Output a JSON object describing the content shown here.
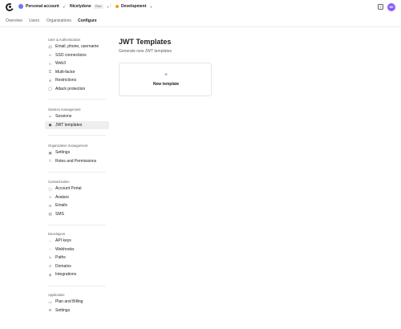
{
  "topbar": {
    "account_label": "Personal account",
    "app_label": "Nicelydone",
    "app_badge": "Free",
    "env_label": "Development",
    "help_glyph": "?",
    "user_initials": "ND",
    "colors": {
      "accent": "#6c47ff",
      "env_dot": "#f59e0b",
      "account_avatar": "#6c73ff",
      "user_avatar": "#8b5cf6"
    }
  },
  "tabs": [
    {
      "label": "Overview"
    },
    {
      "label": "Users"
    },
    {
      "label": "Organizations"
    },
    {
      "label": "Configure",
      "active": true
    }
  ],
  "sidebar": {
    "sections": [
      {
        "title": "User & Authentication",
        "items": [
          {
            "label": "Email, phone, username",
            "icon": "at-icon"
          },
          {
            "label": "SSO connections",
            "icon": "link-icon"
          },
          {
            "label": "Web3",
            "icon": "web3-icon"
          },
          {
            "label": "Multi-factor",
            "icon": "key-icon"
          },
          {
            "label": "Restrictions",
            "icon": "ban-icon"
          },
          {
            "label": "Attack protection",
            "icon": "shield-icon"
          }
        ]
      },
      {
        "title": "Session management",
        "items": [
          {
            "label": "Sessions",
            "icon": "session-icon"
          },
          {
            "label": "JWT templates",
            "icon": "jwt-icon",
            "active": true
          }
        ]
      },
      {
        "title": "Organization management",
        "items": [
          {
            "label": "Settings",
            "icon": "settings-icon"
          },
          {
            "label": "Roles and Permissions",
            "icon": "roles-icon"
          }
        ]
      },
      {
        "title": "Customization",
        "items": [
          {
            "label": "Account Portal",
            "icon": "portal-icon"
          },
          {
            "label": "Avatars",
            "icon": "avatar-icon"
          },
          {
            "label": "Emails",
            "icon": "email-icon"
          },
          {
            "label": "SMS",
            "icon": "sms-icon"
          }
        ]
      },
      {
        "title": "Developers",
        "items": [
          {
            "label": "API keys",
            "icon": "api-key-icon"
          },
          {
            "label": "Webhooks",
            "icon": "webhook-icon"
          },
          {
            "label": "Paths",
            "icon": "paths-icon"
          },
          {
            "label": "Domains",
            "icon": "globe-icon"
          },
          {
            "label": "Integrations",
            "icon": "integrations-icon"
          }
        ]
      },
      {
        "title": "Application",
        "items": [
          {
            "label": "Plan and Billing",
            "icon": "billing-icon"
          },
          {
            "label": "Settings",
            "icon": "settings-icon"
          }
        ]
      }
    ]
  },
  "main": {
    "title": "JWT Templates",
    "subtitle": "Generate new JWT templates",
    "new_card": {
      "plus": "+",
      "label": "New template"
    }
  }
}
